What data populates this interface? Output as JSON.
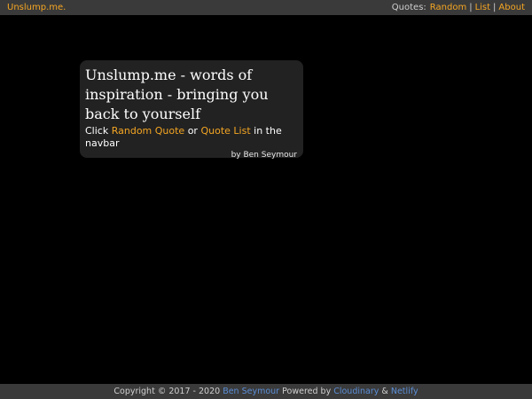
{
  "navbar": {
    "brand": "Unslump.me.",
    "quotes_label": "Quotes:",
    "random_label": "Random",
    "separator": "|",
    "list_label": "List",
    "about_label": "About"
  },
  "hero": {
    "title": "Unslump.me - words of inspiration - bringing you back to yourself",
    "click_text": "Click",
    "random_quote_link": "Random Quote",
    "or_text": "or",
    "quote_list_link": "Quote List",
    "navbar_text": "in the navbar",
    "byline": "by Ben Seymour"
  },
  "footer": {
    "copyright": "Copyright © 2017 - 2020",
    "author_link": "Ben Seymour",
    "powered_by": "Powered by",
    "cloudinary_link": "Cloudinary",
    "amp": "&",
    "netlify_link": "Netlify"
  },
  "colors": {
    "accent": "#f5a623",
    "footer_link": "#5b8ed6",
    "bar": "#3a3a3a",
    "card": "#222222",
    "background": "#000000"
  }
}
